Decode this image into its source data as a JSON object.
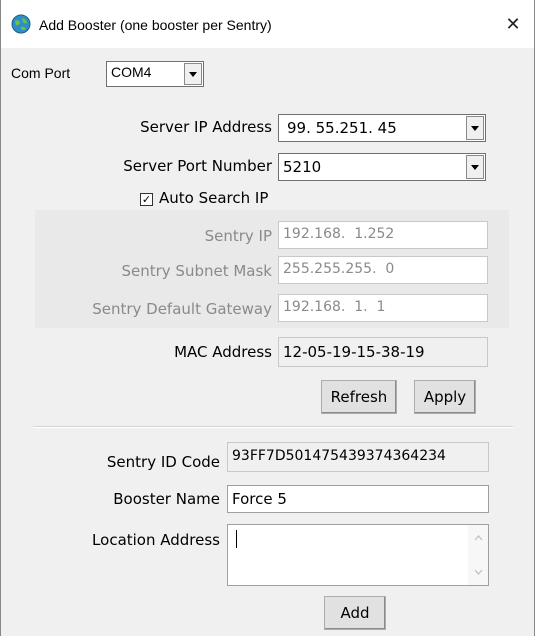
{
  "window": {
    "title": "Add Booster (one booster per Sentry)",
    "close_glyph": "✕"
  },
  "com_port": {
    "label": "Com Port",
    "value": "COM4"
  },
  "server_ip": {
    "label": "Server IP Address",
    "value": "99. 55.251. 45"
  },
  "server_port": {
    "label": "Server Port Number",
    "value": "5210"
  },
  "auto_search": {
    "label": "Auto Search IP",
    "checked": true,
    "check_glyph": "✓"
  },
  "sentry_ip": {
    "label": "Sentry IP",
    "value": "192.168.  1.252"
  },
  "subnet": {
    "label": "Sentry Subnet Mask",
    "value": "255.255.255.  0"
  },
  "gateway": {
    "label": "Sentry Default Gateway",
    "value": "192.168.  1.  1"
  },
  "mac": {
    "label": "MAC Address",
    "value": "12-05-19-15-38-19"
  },
  "buttons": {
    "refresh": "Refresh",
    "apply": "Apply",
    "add": "Add"
  },
  "sentry_id": {
    "label": "Sentry ID Code",
    "value": "93FF7D501475439374364234"
  },
  "booster_name": {
    "label": "Booster Name",
    "value": "Force 5"
  },
  "location": {
    "label": "Location Address",
    "value": ""
  },
  "colors": {
    "disabled_text": "#8a8a8a",
    "panel": "#f0f0f0",
    "arrow": "#404040"
  }
}
